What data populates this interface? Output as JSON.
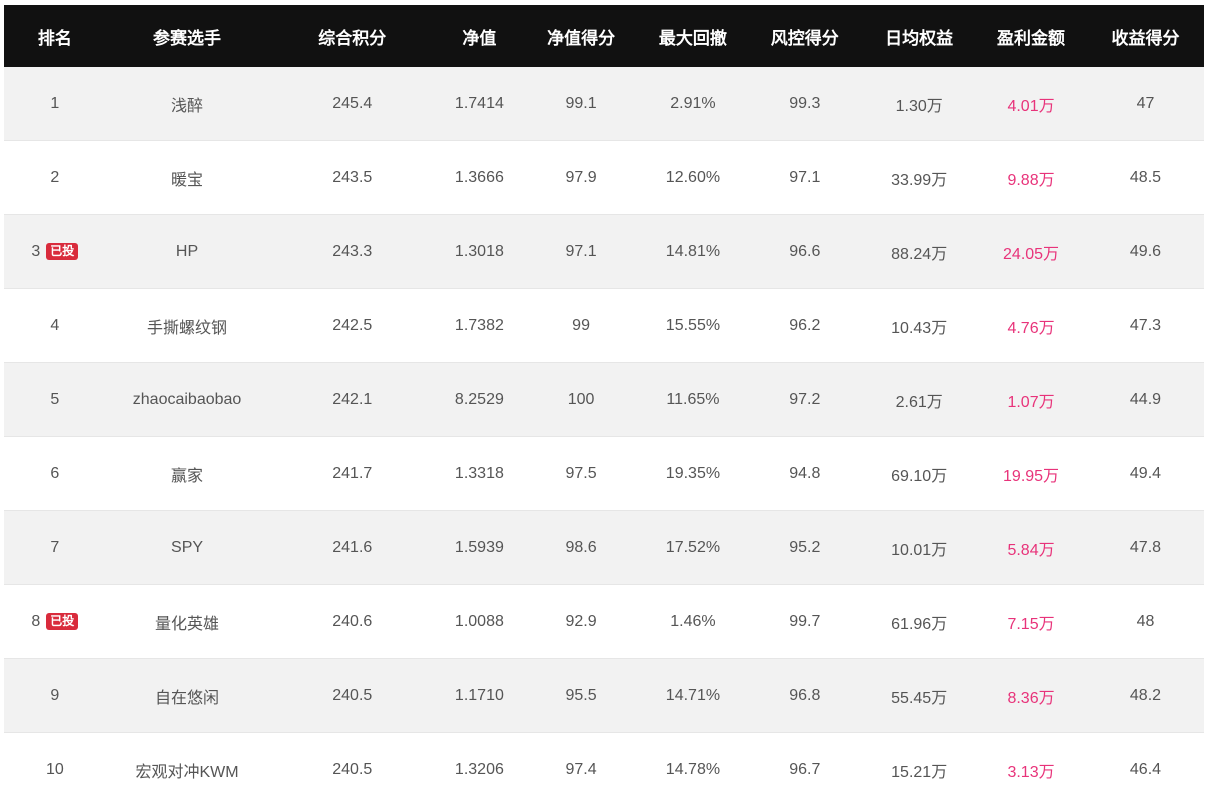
{
  "table": {
    "headers": [
      "排名",
      "参赛选手",
      "综合积分",
      "净值",
      "净值得分",
      "最大回撤",
      "风控得分",
      "日均权益",
      "盈利金额",
      "收益得分"
    ],
    "rows": [
      {
        "rank": "1",
        "badge": "",
        "name": "浅醉",
        "score": "245.4",
        "nav": "1.7414",
        "nav_score": "99.1",
        "max_drawdown": "2.91%",
        "risk_score": "99.3",
        "avg_equity": "1.30万",
        "profit": "4.01万",
        "return_score": "47"
      },
      {
        "rank": "2",
        "badge": "",
        "name": "暖宝",
        "score": "243.5",
        "nav": "1.3666",
        "nav_score": "97.9",
        "max_drawdown": "12.60%",
        "risk_score": "97.1",
        "avg_equity": "33.99万",
        "profit": "9.88万",
        "return_score": "48.5"
      },
      {
        "rank": "3",
        "badge": "已投",
        "name": "HP",
        "score": "243.3",
        "nav": "1.3018",
        "nav_score": "97.1",
        "max_drawdown": "14.81%",
        "risk_score": "96.6",
        "avg_equity": "88.24万",
        "profit": "24.05万",
        "return_score": "49.6"
      },
      {
        "rank": "4",
        "badge": "",
        "name": "手撕螺纹钢",
        "score": "242.5",
        "nav": "1.7382",
        "nav_score": "99",
        "max_drawdown": "15.55%",
        "risk_score": "96.2",
        "avg_equity": "10.43万",
        "profit": "4.76万",
        "return_score": "47.3"
      },
      {
        "rank": "5",
        "badge": "",
        "name": "zhaocaibaobao",
        "score": "242.1",
        "nav": "8.2529",
        "nav_score": "100",
        "max_drawdown": "11.65%",
        "risk_score": "97.2",
        "avg_equity": "2.61万",
        "profit": "1.07万",
        "return_score": "44.9"
      },
      {
        "rank": "6",
        "badge": "",
        "name": "赢家",
        "score": "241.7",
        "nav": "1.3318",
        "nav_score": "97.5",
        "max_drawdown": "19.35%",
        "risk_score": "94.8",
        "avg_equity": "69.10万",
        "profit": "19.95万",
        "return_score": "49.4"
      },
      {
        "rank": "7",
        "badge": "",
        "name": "SPY",
        "score": "241.6",
        "nav": "1.5939",
        "nav_score": "98.6",
        "max_drawdown": "17.52%",
        "risk_score": "95.2",
        "avg_equity": "10.01万",
        "profit": "5.84万",
        "return_score": "47.8"
      },
      {
        "rank": "8",
        "badge": "已投",
        "name": "量化英雄",
        "score": "240.6",
        "nav": "1.0088",
        "nav_score": "92.9",
        "max_drawdown": "1.46%",
        "risk_score": "99.7",
        "avg_equity": "61.96万",
        "profit": "7.15万",
        "return_score": "48"
      },
      {
        "rank": "9",
        "badge": "",
        "name": "自在悠闲",
        "score": "240.5",
        "nav": "1.1710",
        "nav_score": "95.5",
        "max_drawdown": "14.71%",
        "risk_score": "96.8",
        "avg_equity": "55.45万",
        "profit": "8.36万",
        "return_score": "48.2"
      },
      {
        "rank": "10",
        "badge": "",
        "name": "宏观对冲KWM",
        "score": "240.5",
        "nav": "1.3206",
        "nav_score": "97.4",
        "max_drawdown": "14.78%",
        "risk_score": "96.7",
        "avg_equity": "15.21万",
        "profit": "3.13万",
        "return_score": "46.4"
      }
    ]
  },
  "colors": {
    "header_bg": "#111111",
    "header_text": "#ffffff",
    "row_alt_bg": "#f2f2f2",
    "profit_text": "#e8337a",
    "badge_bg": "#d92b3c"
  }
}
